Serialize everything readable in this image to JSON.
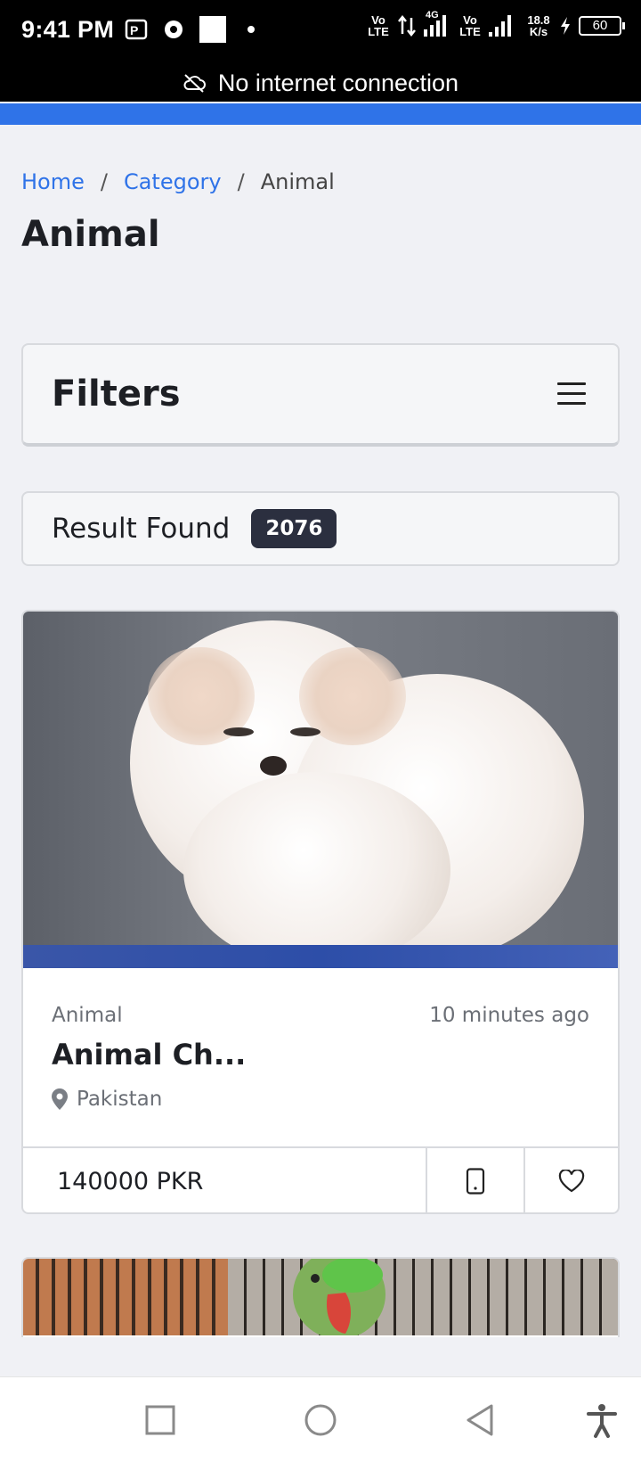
{
  "status_bar": {
    "time": "9:41 PM",
    "network_1": "Vo LTE",
    "network_2": "4G",
    "network_3": "Vo LTE",
    "speed": "18.8 K/s",
    "battery": "60"
  },
  "offline_banner": {
    "text": "No internet connection",
    "icon": "cloud-off-icon"
  },
  "breadcrumb": {
    "items": [
      "Home",
      "Category",
      "Animal"
    ],
    "separator": "/"
  },
  "page_title": "Animal",
  "filters": {
    "label": "Filters",
    "icon": "menu-icon"
  },
  "results": {
    "label": "Result Found",
    "count": "2076"
  },
  "listing": {
    "category": "Animal",
    "posted": "10 minutes ago",
    "title": "Animal Ch...",
    "location": "Pakistan",
    "price": "140000 PKR",
    "photo_subject": "white fluffy puppy",
    "call_icon": "phone-icon",
    "favorite_icon": "heart-icon"
  },
  "next_listing": {
    "photo_subject": "green parrot"
  },
  "colors": {
    "accent": "#2f73e8",
    "badge": "#2b2f3f",
    "background": "#f0f1f5"
  },
  "nav": {
    "icons": [
      "recents-icon",
      "home-icon",
      "back-icon",
      "accessibility-icon"
    ]
  }
}
